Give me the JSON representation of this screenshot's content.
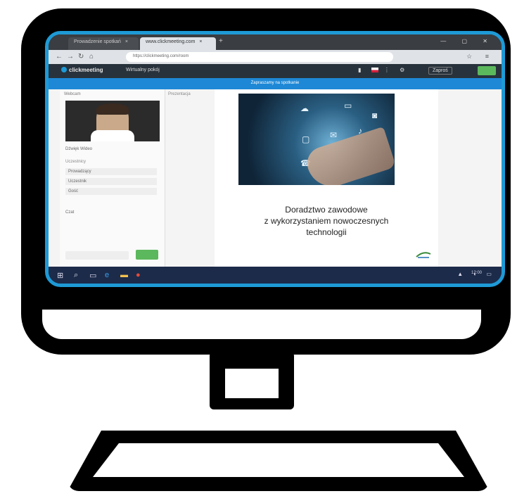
{
  "browser": {
    "tabs": [
      {
        "label": "Prowadzenie spotkań",
        "close": "×"
      },
      {
        "label": "www.clickmeeting.com",
        "close": "×"
      }
    ],
    "new_tab_glyph": "+",
    "address": "https://clickmeeting.com/room",
    "icons": [
      "back-icon",
      "forward-icon",
      "reload-icon",
      "home-icon",
      "star-icon",
      "menu-icon"
    ]
  },
  "app": {
    "logo_text": "clickmeeting",
    "room_name": "Wirtualny pokój",
    "header_button": "Zaproś",
    "banner_text": "Zapraszamy na spotkanie"
  },
  "panel": {
    "title": "Webcam",
    "cam_controls": "Dźwięk   Wideo",
    "list_label": "Uczestnicy",
    "list_items": [
      "Prowadzący",
      "Uczestnik",
      "Gość"
    ],
    "chat_label": "Czat",
    "files_label": "Prezentacja"
  },
  "slide": {
    "line1": "Doradztwo zawodowe",
    "line2": "z wykorzystaniem nowoczesnych",
    "line3": "technologii"
  },
  "taskbar": {
    "clock": "12:00"
  },
  "colors": {
    "accent": "#1e9ad6",
    "banner": "#1e88d6",
    "green_button": "#5cb85c",
    "app_header": "#28323c",
    "taskbar": "#1c2b4a"
  }
}
